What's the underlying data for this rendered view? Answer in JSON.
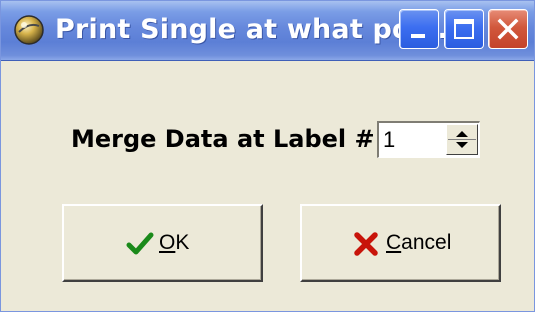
{
  "window": {
    "title": "Print Single at what pos...",
    "icon": "app-globe-icon",
    "controls": {
      "minimize_icon": "minimize-icon",
      "maximize_icon": "maximize-icon",
      "close_icon": "close-icon"
    },
    "colors": {
      "titlebar": "#5c7fd6",
      "face": "#ece9d8",
      "close": "#c4432a"
    }
  },
  "form": {
    "label": "Merge Data at Label #",
    "spin_value": "1",
    "spin_up_icon": "spin-up-icon",
    "spin_down_icon": "spin-down-icon"
  },
  "buttons": {
    "ok": {
      "mnemonic": "O",
      "rest": "K",
      "icon": "checkmark-icon",
      "color": "#1a8a1a"
    },
    "cancel": {
      "mnemonic": "C",
      "rest": "ancel",
      "icon": "red-x-icon",
      "color": "#c8140a"
    }
  }
}
